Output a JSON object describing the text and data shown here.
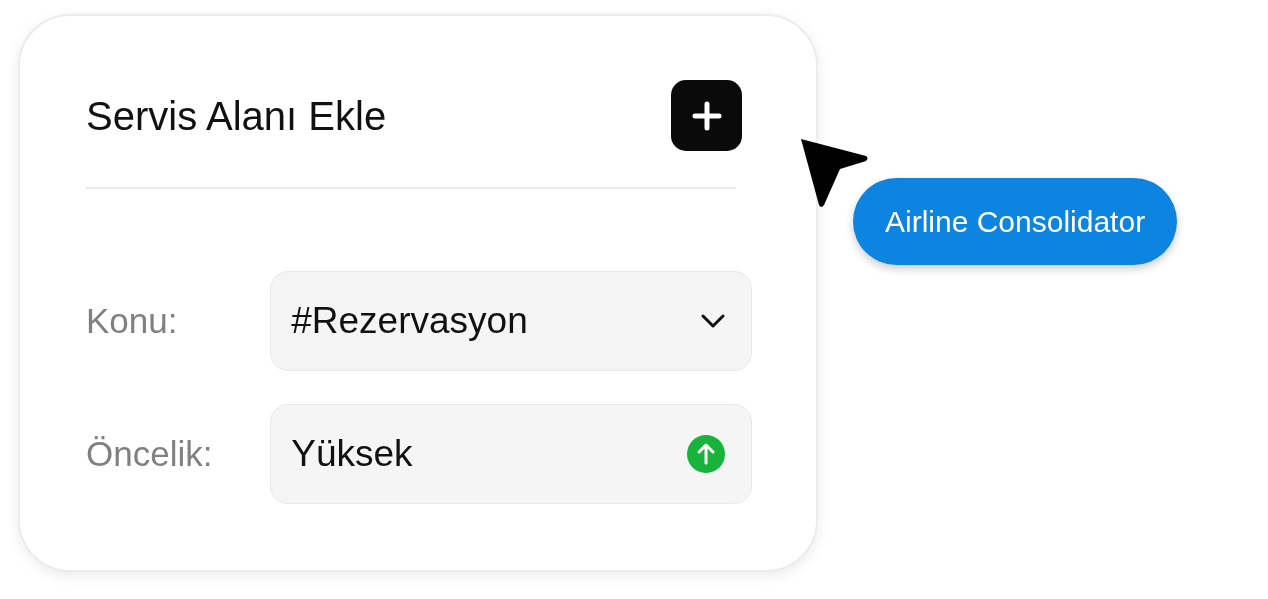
{
  "title": "Servis Alanı Ekle",
  "fields": [
    {
      "label": "Konu:",
      "value": "#Rezervasyon",
      "kind": "select"
    },
    {
      "label": "Öncelik:",
      "value": "Yüksek",
      "kind": "priority"
    }
  ],
  "tag": {
    "label": "Airline Consolidator"
  }
}
